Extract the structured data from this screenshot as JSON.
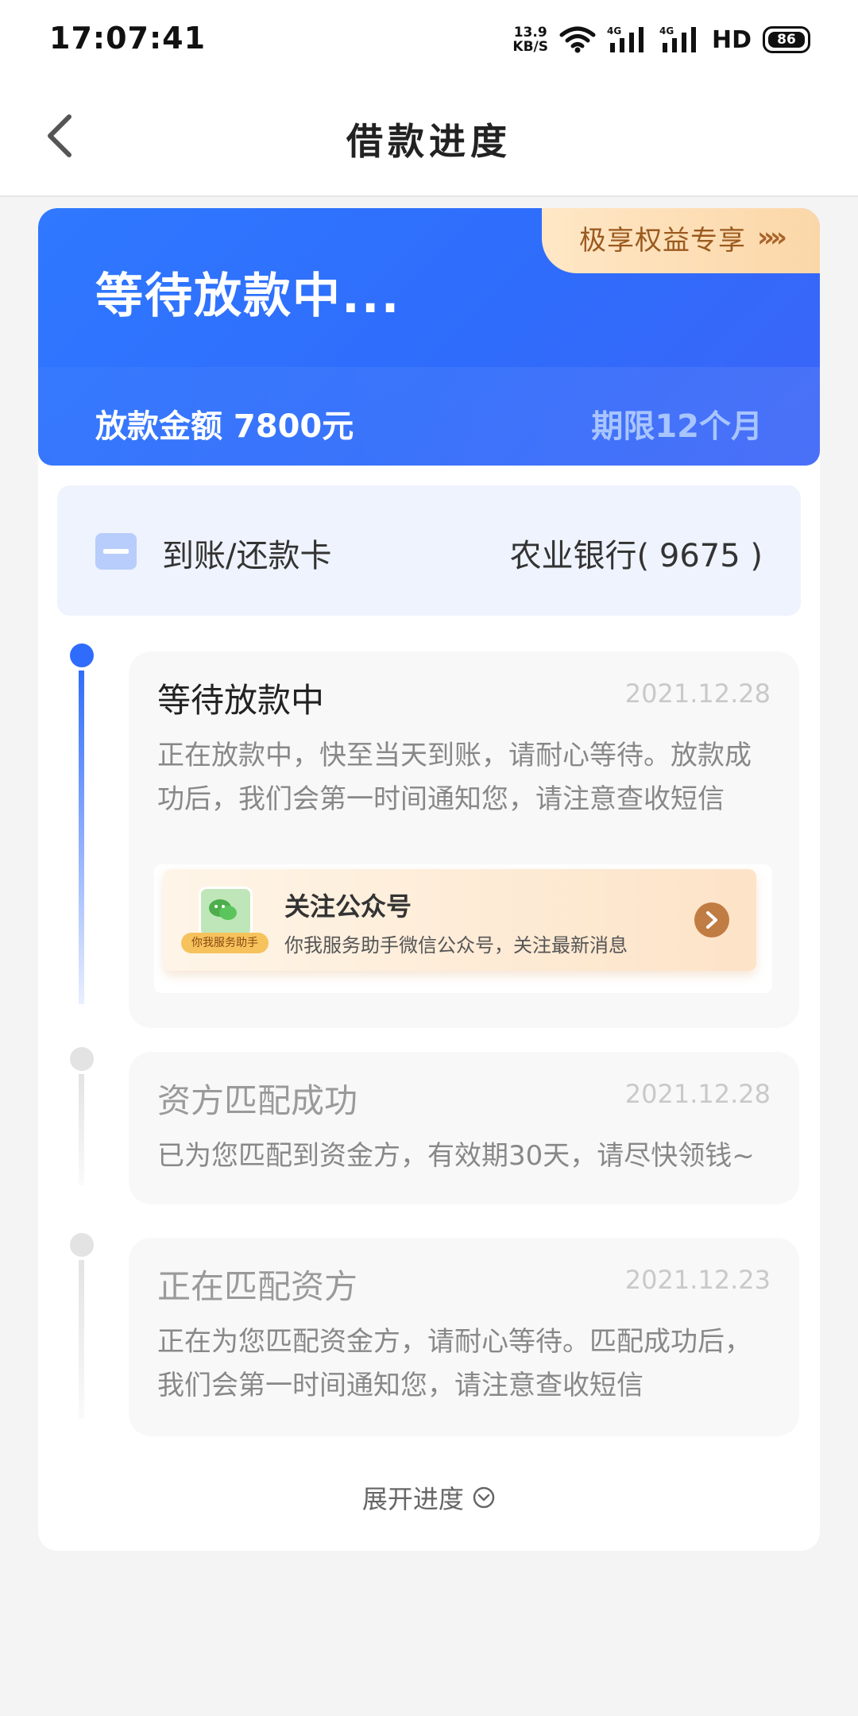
{
  "status_bar": {
    "time": "17:07:41",
    "speed_value": "13.9",
    "speed_unit": "KB/S",
    "network_1": "4G",
    "network_2": "4G",
    "hd": "HD",
    "battery": "86"
  },
  "navbar": {
    "title": "借款进度",
    "back_icon": "chevron-left-icon"
  },
  "hero": {
    "status": "等待放款中...",
    "amount_label": "放款金额 7800元",
    "term": "期限12个月",
    "vip_banner": "极享权益专享",
    "vip_arrow": "»»",
    "colors": {
      "primary": "#2f6cfb",
      "term": "#a9c5ff",
      "vip_text": "#9b5a1f"
    }
  },
  "card": {
    "label": "到账/还款卡",
    "value": "农业银行( 9675 )",
    "icon": "bank-card-icon"
  },
  "timeline": [
    {
      "title": "等待放款中",
      "date": "2021.12.28",
      "desc": "正在放款中，快至当天到账，请耐心等待。放款成功后，我们会第一时间通知您，请注意查收短信",
      "active": true
    },
    {
      "title": "资方匹配成功",
      "date": "2021.12.28",
      "desc": "已为您匹配到资金方，有效期30天，请尽快领钱~",
      "active": false
    },
    {
      "title": "正在匹配资方",
      "date": "2021.12.23",
      "desc": "正在为您匹配资金方，请耐心等待。匹配成功后，我们会第一时间通知您，请注意查收短信",
      "active": false
    }
  ],
  "follow": {
    "title": "关注公众号",
    "subtitle": "你我服务助手微信公众号，关注最新消息",
    "tag": "你我服务助手",
    "icon": "wechat-icon",
    "go_icon": "chevron-right-icon"
  },
  "expand_label": "展开进度",
  "expand_icon": "chevron-down-circle-icon"
}
